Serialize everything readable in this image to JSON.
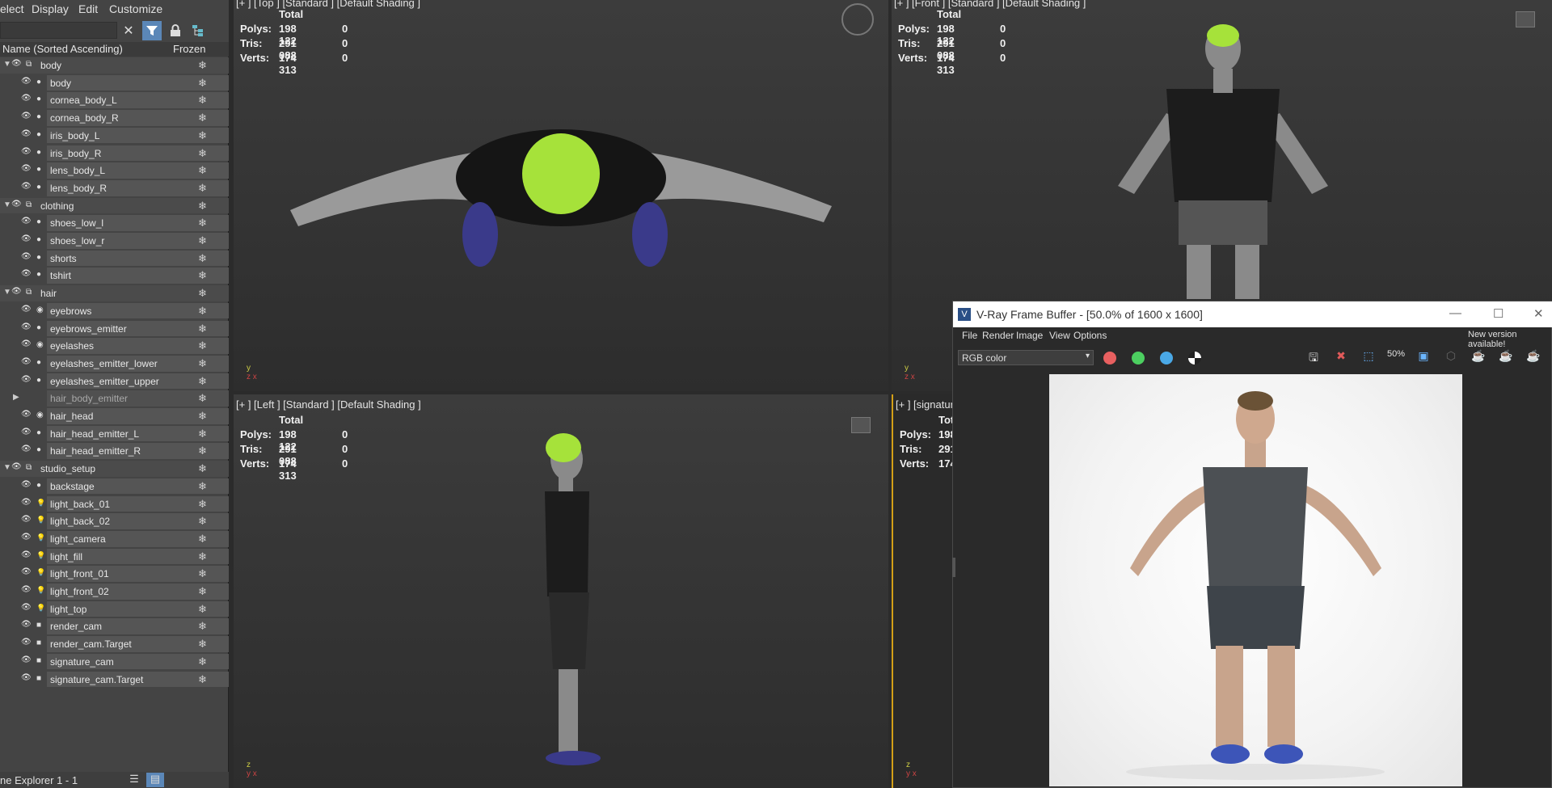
{
  "explorer": {
    "menu": [
      "elect",
      "Display",
      "Edit",
      "Customize"
    ],
    "header": {
      "name": "Name (Sorted Ascending)",
      "frozen": "Frozen"
    },
    "rows": [
      {
        "label": "body",
        "level": 0,
        "expander": "open",
        "kind": "group"
      },
      {
        "label": "body",
        "level": 1,
        "kind": "mesh"
      },
      {
        "label": "cornea_body_L",
        "level": 1,
        "kind": "mesh"
      },
      {
        "label": "cornea_body_R",
        "level": 1,
        "kind": "mesh"
      },
      {
        "label": "iris_body_L",
        "level": 1,
        "kind": "mesh"
      },
      {
        "label": "iris_body_R",
        "level": 1,
        "kind": "mesh"
      },
      {
        "label": "lens_body_L",
        "level": 1,
        "kind": "mesh"
      },
      {
        "label": "lens_body_R",
        "level": 1,
        "kind": "mesh"
      },
      {
        "label": "clothing",
        "level": 0,
        "expander": "open",
        "kind": "group"
      },
      {
        "label": "shoes_low_l",
        "level": 1,
        "kind": "mesh"
      },
      {
        "label": "shoes_low_r",
        "level": 1,
        "kind": "mesh"
      },
      {
        "label": "shorts",
        "level": 1,
        "kind": "mesh"
      },
      {
        "label": "tshirt",
        "level": 1,
        "kind": "mesh"
      },
      {
        "label": "hair",
        "level": 0,
        "expander": "open",
        "kind": "group"
      },
      {
        "label": "eyebrows",
        "level": 1,
        "kind": "hair"
      },
      {
        "label": "eyebrows_emitter",
        "level": 1,
        "kind": "mesh"
      },
      {
        "label": "eyelashes",
        "level": 1,
        "kind": "hair"
      },
      {
        "label": "eyelashes_emitter_lower",
        "level": 1,
        "kind": "mesh"
      },
      {
        "label": "eyelashes_emitter_upper",
        "level": 1,
        "kind": "mesh"
      },
      {
        "label": "hair_body_emitter",
        "level": 1,
        "expander": "closed",
        "kind": "hidden"
      },
      {
        "label": "hair_head",
        "level": 1,
        "kind": "hair"
      },
      {
        "label": "hair_head_emitter_L",
        "level": 1,
        "kind": "mesh"
      },
      {
        "label": "hair_head_emitter_R",
        "level": 1,
        "kind": "mesh"
      },
      {
        "label": "studio_setup",
        "level": 0,
        "expander": "open",
        "kind": "group"
      },
      {
        "label": "backstage",
        "level": 1,
        "kind": "mesh"
      },
      {
        "label": "light_back_01",
        "level": 1,
        "kind": "light"
      },
      {
        "label": "light_back_02",
        "level": 1,
        "kind": "light"
      },
      {
        "label": "light_camera",
        "level": 1,
        "kind": "light"
      },
      {
        "label": "light_fill",
        "level": 1,
        "kind": "light"
      },
      {
        "label": "light_front_01",
        "level": 1,
        "kind": "light"
      },
      {
        "label": "light_front_02",
        "level": 1,
        "kind": "light"
      },
      {
        "label": "light_top",
        "level": 1,
        "kind": "light"
      },
      {
        "label": "render_cam",
        "level": 1,
        "kind": "camera"
      },
      {
        "label": "render_cam.Target",
        "level": 1,
        "kind": "camera"
      },
      {
        "label": "signature_cam",
        "level": 1,
        "kind": "camera"
      },
      {
        "label": "signature_cam.Target",
        "level": 1,
        "kind": "camera"
      }
    ],
    "status": "ne Explorer 1 - 1"
  },
  "viewports": {
    "top": {
      "label": "[+ ] [Top ] [Standard ] [Default Shading ]"
    },
    "front": {
      "label": "[+ ] [Front ] [Standard ] [Default Shading ]"
    },
    "left": {
      "label": "[+ ] [Left ] [Standard ] [Default Shading ]"
    },
    "signature": {
      "label": "[+ ] [signatur"
    },
    "stats": {
      "total": "Total",
      "polys_label": "Polys:",
      "polys": "198 122",
      "polys_sel": "0",
      "tris_label": "Tris:",
      "tris": "291 088",
      "tris_sel": "0",
      "verts_label": "Verts:",
      "verts": "174 313",
      "verts_sel": "0"
    },
    "stats_cut": {
      "total": "Tot",
      "polys": "198",
      "tris": "291",
      "verts": "174"
    }
  },
  "vfb": {
    "title": "V-Ray Frame Buffer - [50.0% of 1600 x 1600]",
    "menu": [
      "File",
      "Render",
      "Image",
      "View",
      "Options"
    ],
    "notice": "New version available!",
    "channel": "RGB color",
    "zoom": "50%"
  },
  "colors": {
    "hair_green": "#a6e23a",
    "viewport_active_border": "#d4a017",
    "explorer_filter_active": "#5b87b8"
  }
}
